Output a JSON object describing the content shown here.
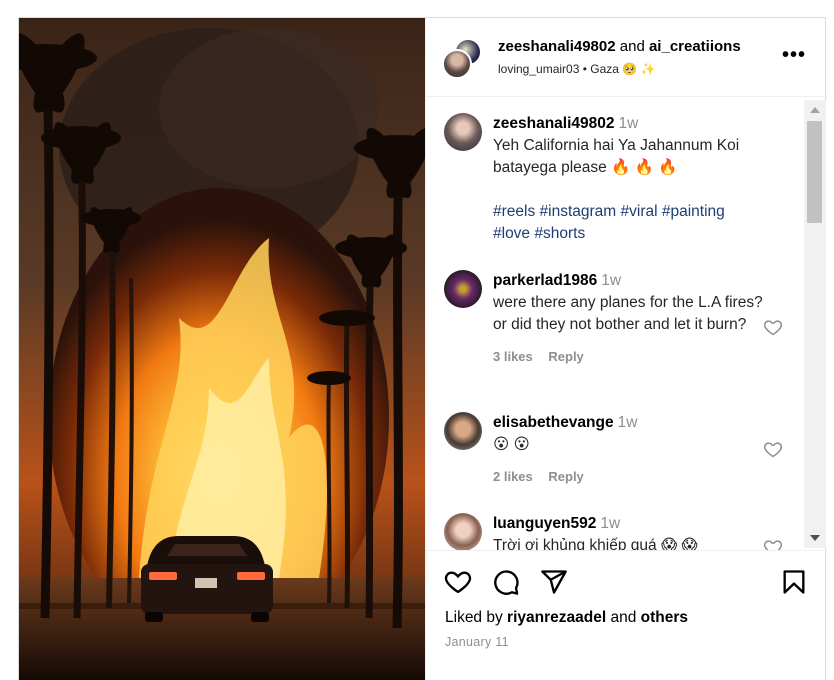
{
  "post": {
    "header": {
      "owner1": "zeeshanali49802",
      "and_text": "and",
      "owner2": "ai_creatiions",
      "sub_user": "loving_umair03",
      "separator": "•",
      "location": "Gaza 🥺 ✨",
      "more_icon": "more-horizontal-icon"
    },
    "comments": [
      {
        "username": "zeeshanali49802",
        "time": "1w",
        "text": "Yeh California hai Ya Jahannum Koi batayega please 🔥 🔥 🔥",
        "tags": "#reels #instagram #viral #painting #love #shorts"
      },
      {
        "username": "parkerlad1986",
        "time": "1w",
        "text": "were there any planes for the L.A fires? or did they not bother and let it burn?",
        "likes": "3 likes",
        "reply": "Reply"
      },
      {
        "username": "elisabethevange",
        "time": "1w",
        "text": "😮 😮",
        "likes": "2 likes",
        "reply": "Reply"
      },
      {
        "username": "luanguyen592",
        "time": "1w",
        "text": "Trời ơi khủng khiếp quá 😱 😱"
      }
    ],
    "actions": {
      "icons": [
        "heart-icon",
        "comment-icon",
        "share-icon",
        "bookmark-icon"
      ],
      "liked_by_prefix": "Liked by",
      "liked_by_user": "riyanrezaadel",
      "liked_by_and": "and",
      "liked_by_others": "others",
      "date": "January 11"
    }
  }
}
